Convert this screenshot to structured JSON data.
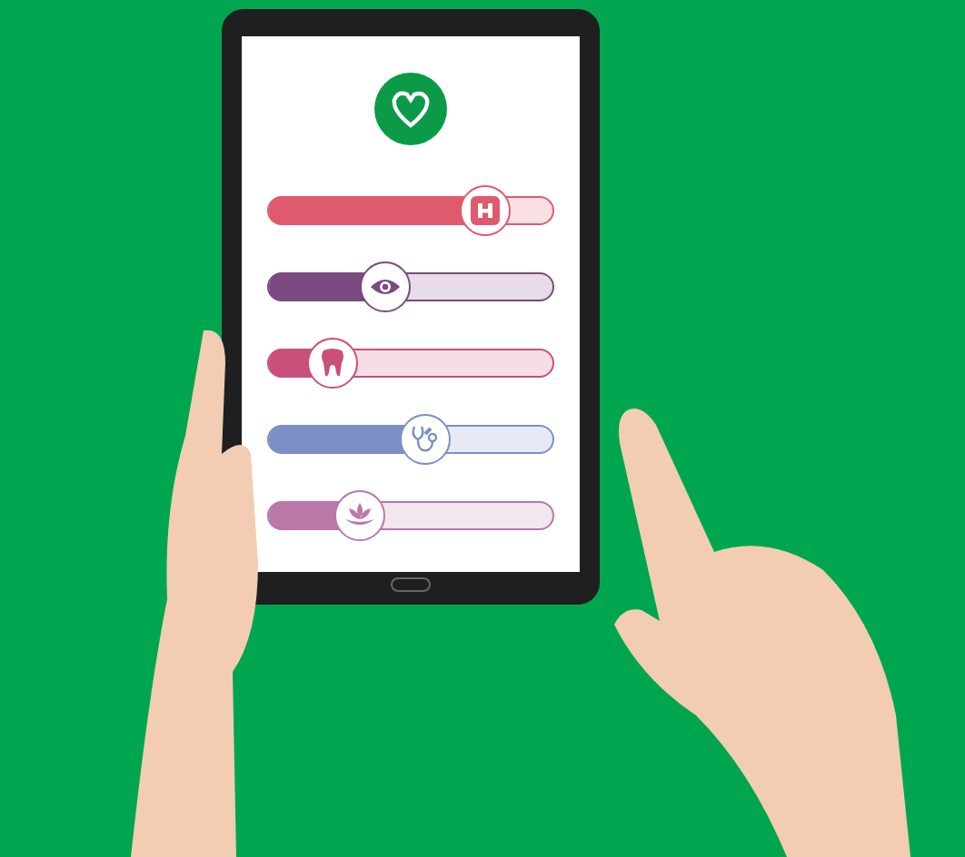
{
  "sliders": [
    {
      "kind": "hospital",
      "level": 0.76,
      "color": "#e05a6e"
    },
    {
      "kind": "eye",
      "level": 0.41,
      "color": "#7a4a80"
    },
    {
      "kind": "tooth",
      "level": 0.23,
      "color": "#c9507a"
    },
    {
      "kind": "stethoscope",
      "level": 0.55,
      "color": "#7b90c4"
    },
    {
      "kind": "lotus",
      "level": 0.32,
      "color": "#b878a8"
    }
  ]
}
